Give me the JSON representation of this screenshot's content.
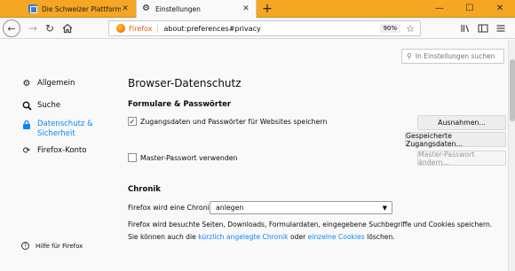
{
  "tabs": [
    {
      "label": "Die Schweizer Plattform für Cu",
      "active": false
    },
    {
      "label": "Einstellungen",
      "active": true
    }
  ],
  "window_controls": {
    "minimize": "—",
    "maximize": "☐",
    "close": "✕"
  },
  "urlbar": {
    "identity": "Firefox",
    "url": "about:preferences#privacy",
    "zoom": "90%"
  },
  "search": {
    "placeholder": "In Einstellungen suchen"
  },
  "sidebar": {
    "items": [
      {
        "label": "Allgemein",
        "icon": "gear-icon"
      },
      {
        "label": "Suche",
        "icon": "search-icon"
      },
      {
        "label": "Datenschutz & Sicherheit",
        "icon": "lock-icon",
        "selected": true
      },
      {
        "label": "Firefox-Konto",
        "icon": "sync-icon"
      }
    ],
    "help": "Hilfe für Firefox"
  },
  "main": {
    "title": "Browser-Datenschutz",
    "logins": {
      "heading": "Formulare & Passwörter",
      "save_logins": "Zugangsdaten und Passwörter für Websites speichern",
      "save_logins_checked": true,
      "exceptions_button": "Ausnahmen...",
      "saved_logins_button": "Gespeicherte Zugangsdaten...",
      "master_password": "Master-Passwort verwenden",
      "master_password_checked": false,
      "change_master_button": "Master-Passwort ändern..."
    },
    "history": {
      "heading": "Chronik",
      "label": "Firefox wird eine Chronik",
      "selected": "anlegen",
      "desc1": "Firefox wird besuchte Seiten, Downloads, Formulardaten, eingegebene Suchbegriffe und Cookies speichern.",
      "desc2_pre": "Sie können auch die ",
      "link1": "kürzlich angelegte Chronik",
      "desc2_mid": " oder ",
      "link2": "einzelne Cookies",
      "desc2_post": " löschen."
    }
  },
  "colors": {
    "titlebar": "#f5a623",
    "accent": "#0a84ff",
    "brand": "#e66000"
  }
}
